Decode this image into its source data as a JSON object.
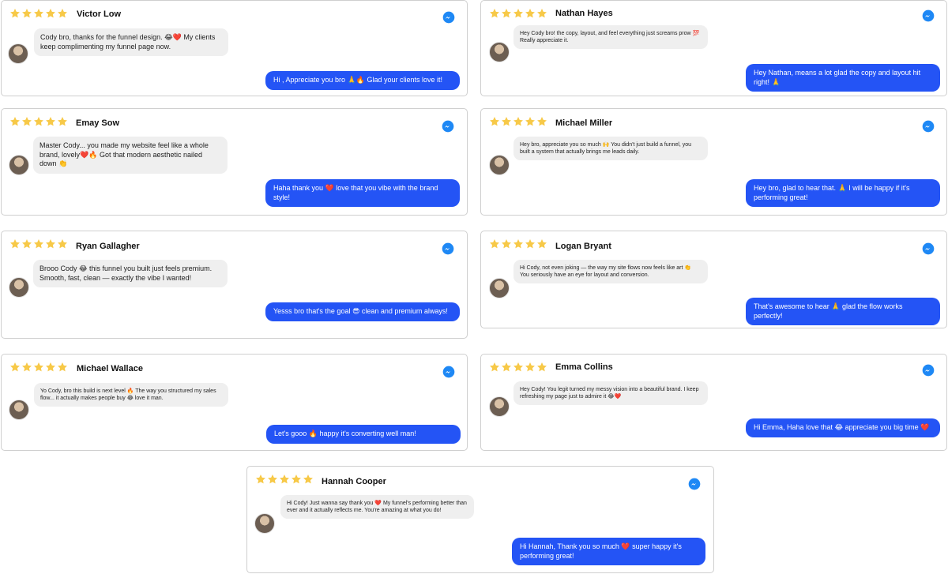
{
  "rating_color": "#f7c948",
  "accent_color": "#2454f5",
  "messenger_color": "#1e88f5",
  "icons": {
    "star": "star-icon",
    "messenger": "messenger-icon"
  },
  "reviews": [
    {
      "name": "Victor Low",
      "rating": 5,
      "incoming": "Cody bro, thanks for the funnel design. 😂❤️ My clients keep complimenting my funnel page now.",
      "reply": "Hi , Appreciate you bro 🙏🔥 Glad your clients love it!"
    },
    {
      "name": "Nathan Hayes",
      "rating": 5,
      "incoming": "Hey Cody bro! the copy, layout, and feel everything just screams prow 💯 Really appreciate it.",
      "reply": "Hey Nathan, means a lot glad the copy and layout hit right! 🙏"
    },
    {
      "name": "Emay Sow",
      "rating": 5,
      "incoming": "Master Cody... you made my website feel like a whole brand, lovely❤️🔥 Got that modern aesthetic nailed down 👏",
      "reply": "Haha thank you ❤️ love that you vibe with the brand style!"
    },
    {
      "name": "Michael Miller",
      "rating": 5,
      "incoming": "Hey bro, appreciate you so much 🙌 You didn't just build a funnel, you built a system that actually brings me leads daily.",
      "reply": "Hey bro, glad to hear that. 🙏 I will be happy if it's performing great!"
    },
    {
      "name": "Ryan Gallagher",
      "rating": 5,
      "incoming": "Brooo Cody 😂 this funnel you built just feels premium. Smooth, fast, clean — exactly the vibe I wanted!",
      "reply": "Yesss bro that's the goal 😎 clean and premium always!"
    },
    {
      "name": "Logan Bryant",
      "rating": 5,
      "incoming": "Hi Cody, not even joking — the way my site flows now feels like art 👏 You seriously have an eye for layout and conversion.",
      "reply": "That's awesome to hear 🙏 glad the flow works perfectly!"
    },
    {
      "name": "Michael Wallace",
      "rating": 5,
      "incoming": "Yo Cody, bro this build is next level 🔥 The way you structured my sales flow... it actually makes people buy 😂 love it man.",
      "reply": "Let's gooo 🔥 happy it's converting well man!"
    },
    {
      "name": "Emma Collins",
      "rating": 5,
      "incoming": "Hey Cody! You legit turned my messy vision into a beautiful brand. I keep refreshing my page just to admire it 😂❤️",
      "reply": "Hi Emma, Haha love that 😂 appreciate you big time ❤️"
    },
    {
      "name": "Hannah Cooper",
      "rating": 5,
      "incoming": "Hi Cody! Just wanna say thank you ❤️ My funnel's performing better than ever and it actually reflects me. You're amazing at what you do!",
      "reply": "Hi Hannah, Thank you so much ❤️ super happy it's performing great!"
    }
  ]
}
